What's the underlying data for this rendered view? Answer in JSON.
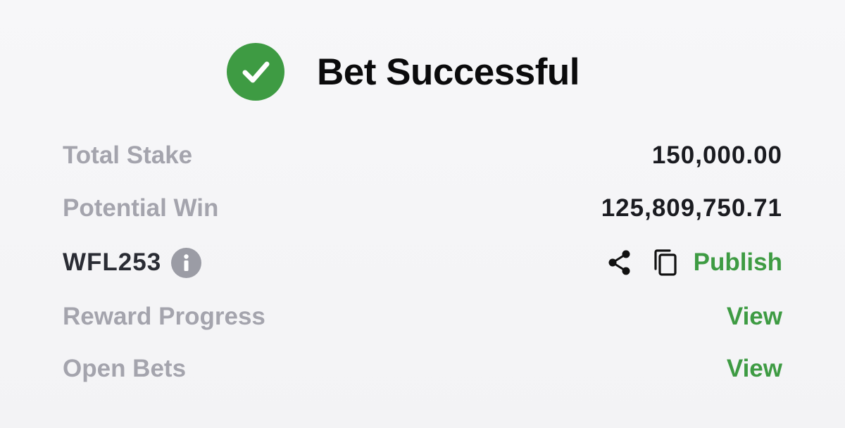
{
  "header": {
    "icon": "check-circle-icon",
    "title": "Bet Successful"
  },
  "rows": {
    "total_stake": {
      "label": "Total Stake",
      "value": "150,000.00"
    },
    "potential_win": {
      "label": "Potential Win",
      "value": "125,809,750.71"
    },
    "bet_code": {
      "id": "WFL253",
      "info_icon": "info-icon",
      "share_icon": "share-icon",
      "copy_icon": "copy-icon",
      "publish_label": "Publish"
    },
    "reward_progress": {
      "label": "Reward Progress",
      "link": "View"
    },
    "open_bets": {
      "label": "Open Bets",
      "link": "View"
    }
  },
  "colors": {
    "accent_green": "#3e9b43",
    "label_gray": "#a4a4ad",
    "value_dark": "#1a1b20",
    "info_gray": "#9b9ca5"
  }
}
